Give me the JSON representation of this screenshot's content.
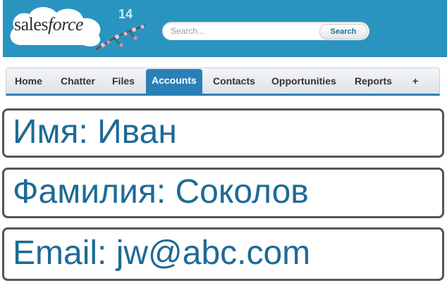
{
  "header": {
    "logo": "salesforce",
    "release": "14",
    "search": {
      "placeholder": "Search...",
      "button_label": "Search"
    }
  },
  "tabs": [
    {
      "label": "Home"
    },
    {
      "label": "Chatter"
    },
    {
      "label": "Files"
    },
    {
      "label": "Accounts",
      "active": true
    },
    {
      "label": "Contacts"
    },
    {
      "label": "Opportunities"
    },
    {
      "label": "Reports"
    },
    {
      "label": "+"
    }
  ],
  "fields": [
    {
      "text": "Имя: Иван"
    },
    {
      "text": "Фамилия: Соколов"
    },
    {
      "text": "Email: jw@abc.com"
    }
  ],
  "colors": {
    "header_bg": "#2a94c1",
    "active_tab": "#2a7fb6",
    "field_text": "#1e6a96"
  }
}
